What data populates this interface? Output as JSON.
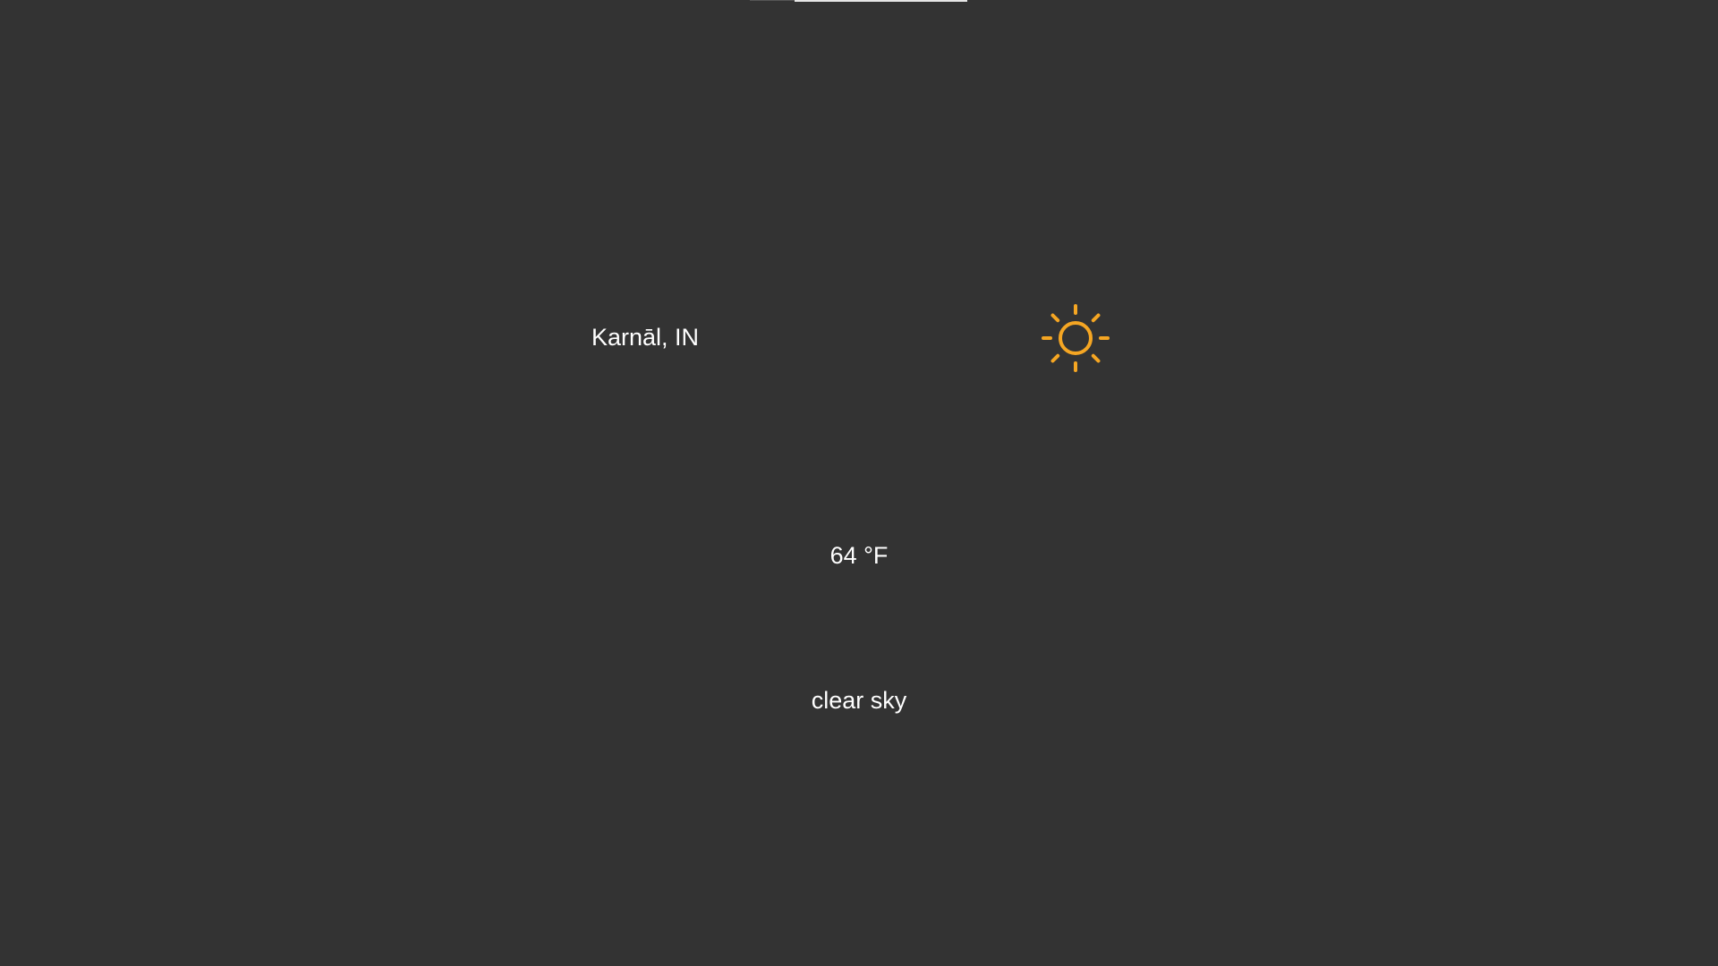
{
  "weather": {
    "location": "Karnāl, IN",
    "temperature": "64 °F",
    "description": "clear sky",
    "icon": "sun-icon",
    "icon_color": "#F5A623"
  },
  "colors": {
    "background": "#333333",
    "text": "#FFFFFF"
  }
}
